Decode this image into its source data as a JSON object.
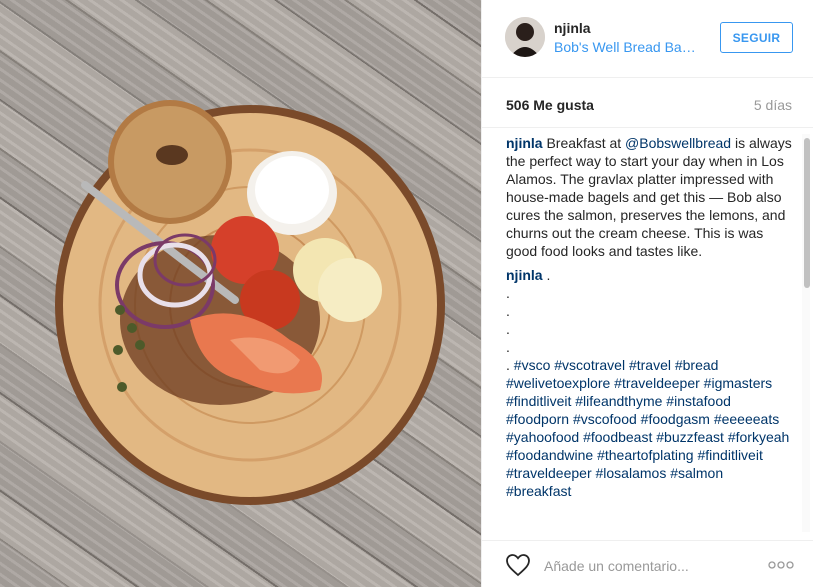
{
  "post": {
    "username": "njinla",
    "location": "Bob's Well Bread Bakery",
    "follow_label": "SEGUIR",
    "likes": "506 Me gusta",
    "time_ago": "5 días"
  },
  "caption": {
    "username": "njinla",
    "text_before": " Breakfast at ",
    "mention": "@Bobswellbread",
    "text_after": " is always the perfect way to start your day when in Los Alamos. The gravlax platter impressed with house-made bagels and get this — Bob also cures the salmon, preserves the lemons, and churns out the cream cheese. This is was good food looks and tastes like."
  },
  "second_comment": {
    "username": "njinla",
    "first_line": " .",
    "dots": [
      ".",
      ".",
      ".",
      "."
    ],
    "tag_prefix": ". ",
    "hashtags": "#vsco #vscotravel #travel #bread #welivetoexplore #traveldeeper #igmasters #finditliveit #lifeandthyme #instafood #foodporn #vscofood #foodgasm #eeeeeats #yahoofood #foodbeast #buzzfeast #forkyeah #foodandwine #theartofplating #finditliveit #traveldeeper #losalamos #salmon #breakfast"
  },
  "footer": {
    "comment_placeholder": "Añade un comentario..."
  },
  "icons": {
    "like": "heart-outline-icon",
    "more": "more-options-icon"
  },
  "colors": {
    "link": "#3897f0",
    "user": "#003569",
    "muted": "#999999"
  }
}
